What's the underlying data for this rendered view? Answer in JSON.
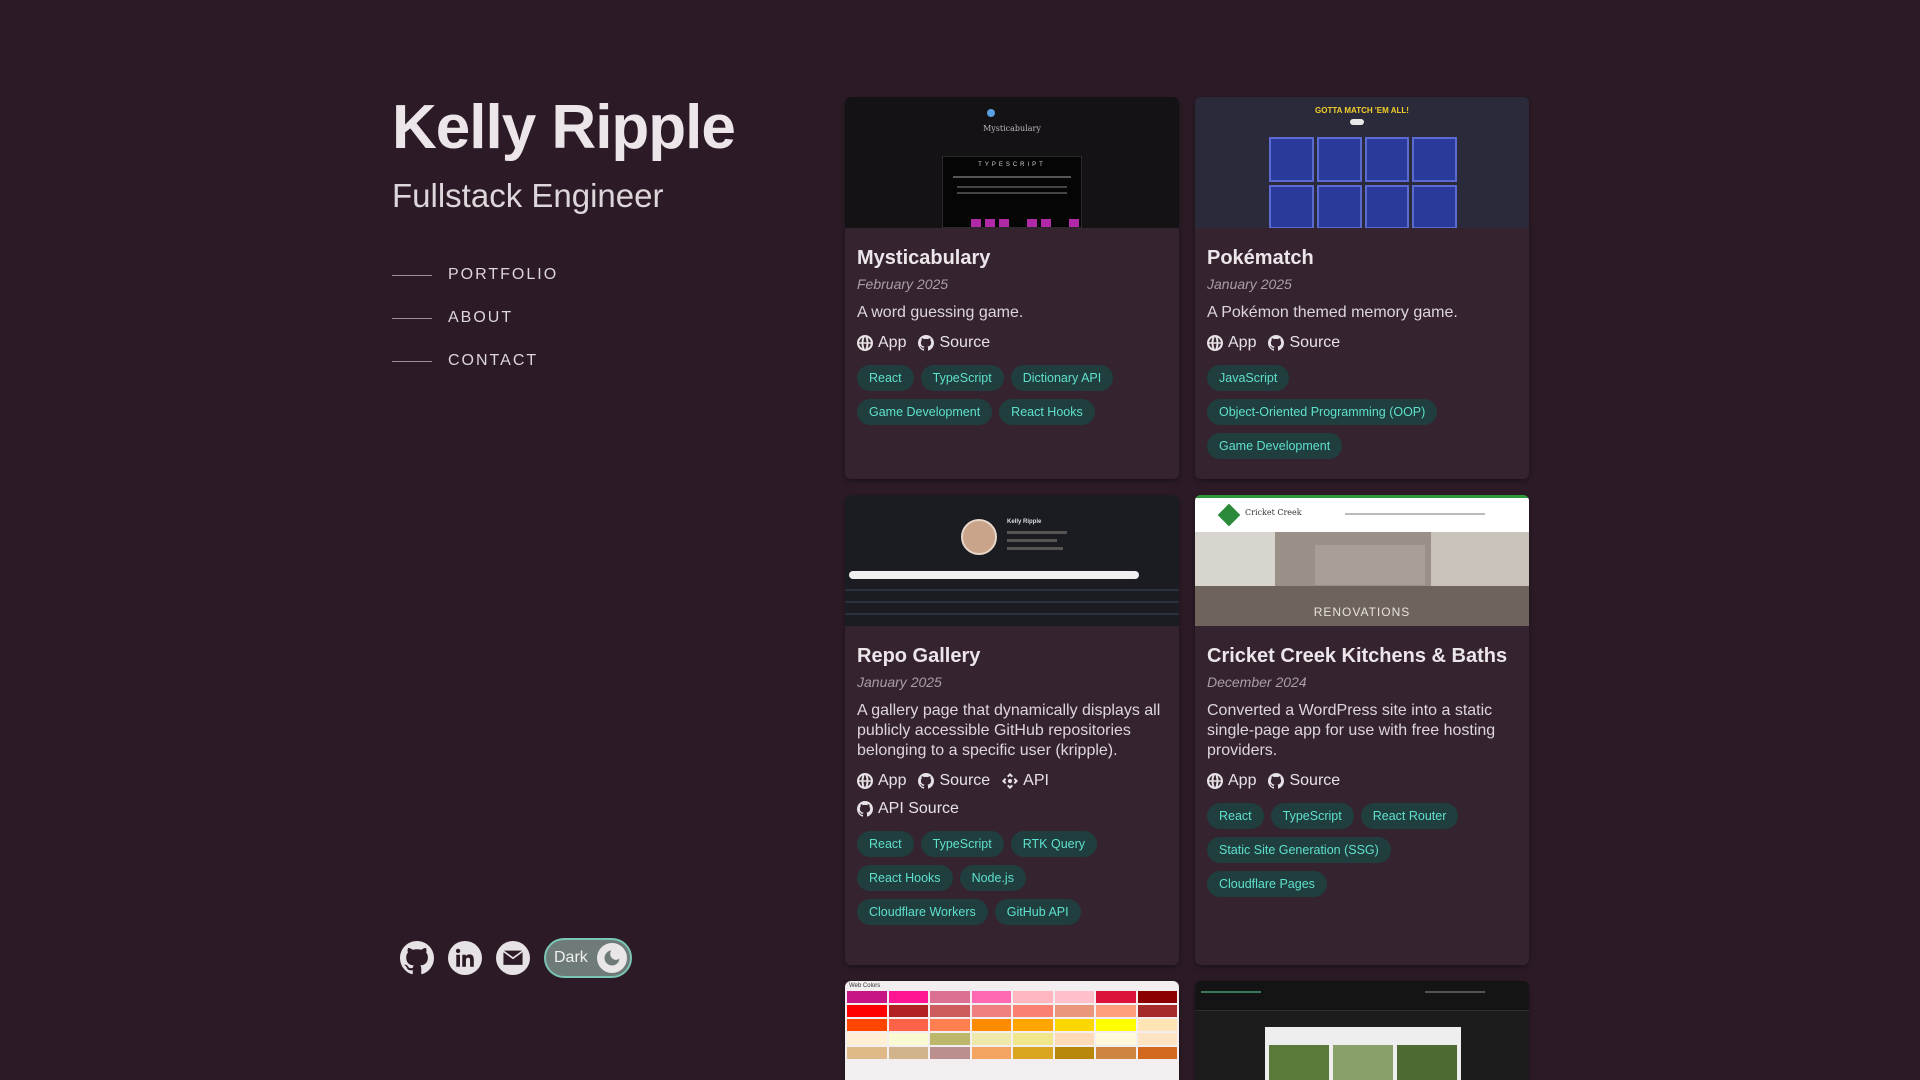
{
  "profile": {
    "name": "Kelly Ripple",
    "role": "Fullstack Engineer"
  },
  "nav": {
    "items": [
      {
        "label": "PORTFOLIO"
      },
      {
        "label": "ABOUT"
      },
      {
        "label": "CONTACT"
      }
    ]
  },
  "social": {
    "icons": [
      "github-icon",
      "linkedin-icon",
      "email-icon"
    ],
    "theme_toggle_label": "Dark"
  },
  "colors": {
    "background": "#2c1b26",
    "card": "#352430",
    "tag_bg": "#1f3e3d",
    "tag_text": "#5fe0ce",
    "toggle_border": "#79c6b6"
  },
  "cards": [
    {
      "title": "Mysticabulary",
      "date": "February 2025",
      "description": "A word guessing game.",
      "links": [
        "App",
        "Source"
      ],
      "tags": [
        "React",
        "TypeScript",
        "Dictionary API",
        "Game Development",
        "React Hooks"
      ],
      "thumb_title": "Mysticabulary",
      "thumb_word": "TYPESCRIPT"
    },
    {
      "title": "Pokématch",
      "date": "January 2025",
      "description": "A Pokémon themed memory game.",
      "links": [
        "App",
        "Source"
      ],
      "tags": [
        "JavaScript",
        "Object-Oriented Programming (OOP)",
        "Game Development"
      ],
      "thumb_title": "GOTTA MATCH 'EM ALL!"
    },
    {
      "title": "Repo Gallery",
      "date": "January 2025",
      "description": "A gallery page that dynamically displays all publicly accessible GitHub repositories belonging to a specific user (kripple).",
      "links": [
        "App",
        "Source",
        "API",
        "API Source"
      ],
      "tags": [
        "React",
        "TypeScript",
        "RTK Query",
        "React Hooks",
        "Node.js",
        "Cloudflare Workers",
        "GitHub API"
      ],
      "thumb_title": "Kelly Ripple"
    },
    {
      "title": "Cricket Creek Kitchens & Baths",
      "date": "December 2024",
      "description": "Converted a WordPress site into a static single-page app for use with free hosting providers.",
      "links": [
        "App",
        "Source"
      ],
      "tags": [
        "React",
        "TypeScript",
        "React Router",
        "Static Site Generation (SSG)",
        "Cloudflare Pages"
      ],
      "thumb_title": "Cricket Creek",
      "thumb_banner": "RENOVATIONS"
    },
    {
      "thumb_title": "Web Colors"
    },
    {
      "thumb_title": ""
    }
  ]
}
